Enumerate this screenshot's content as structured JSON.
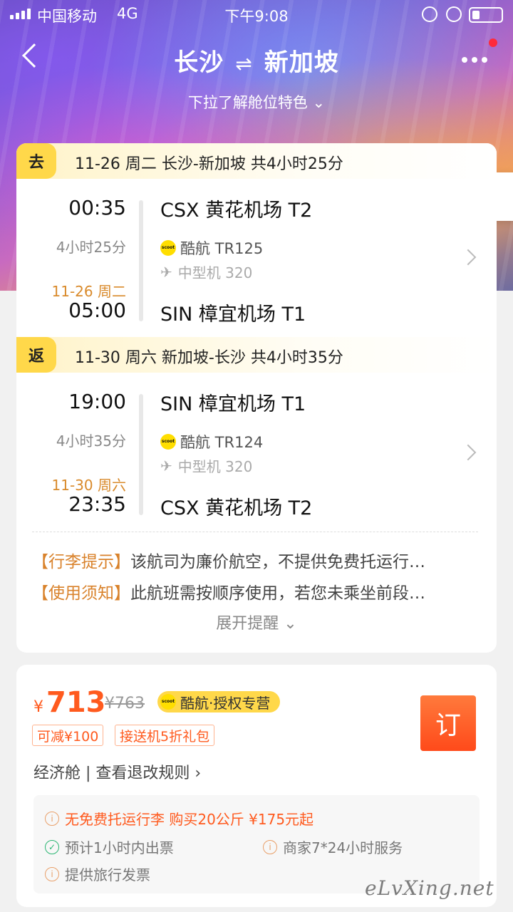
{
  "status": {
    "carrier": "中国移动",
    "network": "4G",
    "time": "下午9:08"
  },
  "nav": {
    "from": "长沙",
    "to": "新加坡",
    "arrow": "⇌",
    "pull_hint": "下拉了解舱位特色",
    "chevron": "⌄",
    "back_icon": "chevron-left-icon",
    "more_icon": "more-icon"
  },
  "outbound": {
    "tag": "去",
    "title": "11-26 周二  长沙-新加坡  共4小时25分",
    "dep_time": "00:35",
    "duration": "4小时25分",
    "arr_date": "11-26 周二",
    "arr_time": "05:00",
    "dep_airport": "CSX 黄花机场 T2",
    "airline": "酷航 TR125",
    "aircraft": "中型机 320",
    "arr_airport": "SIN 樟宜机场 T1"
  },
  "inbound": {
    "tag": "返",
    "title": "11-30 周六  新加坡-长沙  共4小时35分",
    "dep_time": "19:00",
    "duration": "4小时35分",
    "arr_date": "11-30 周六",
    "arr_time": "23:35",
    "dep_airport": "SIN 樟宜机场 T1",
    "airline": "酷航 TR124",
    "aircraft": "中型机 320",
    "arr_airport": "CSX 黄花机场 T2"
  },
  "notes": [
    {
      "label": "【行李提示】",
      "text": "该航司为廉价航空，不提供免费托运行…"
    },
    {
      "label": "【使用须知】",
      "text": "此航班需按顺序使用，若您未乘坐前段…"
    }
  ],
  "expand_label": "展开提醒 ⌄",
  "offer": {
    "currency": "¥",
    "price": "713",
    "original_price": "¥763",
    "authorized": "酷航·授权专营",
    "discount": "可减¥100",
    "gift": "接送机5折礼包",
    "cabin": "经济舱 | 查看退改规则 ›",
    "book_label": "订"
  },
  "services": {
    "baggage": "无免费托运行李  购买20公斤  ¥175元起",
    "ticket": "预计1小时内出票",
    "support": "商家7*24小时服务",
    "invoice": "提供旅行发票"
  },
  "logo_text": "scoot",
  "watermark": "eLvXing.net",
  "colors": {
    "accent": "#ff5a1e",
    "tag_yellow": "#ffd84a",
    "note_label": "#d9822b"
  }
}
